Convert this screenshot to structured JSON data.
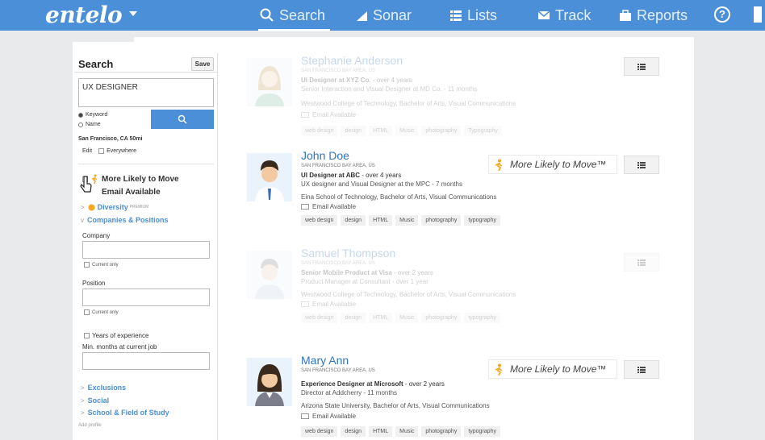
{
  "topbar": {
    "logo": "entelo",
    "nav": [
      {
        "label": "Search",
        "icon": "search-icon"
      },
      {
        "label": "Sonar",
        "icon": "signal-bars-icon"
      },
      {
        "label": "Lists",
        "icon": "list-icon"
      },
      {
        "label": "Track",
        "icon": "envelope-icon"
      },
      {
        "label": "Reports",
        "icon": "briefcase-icon"
      }
    ],
    "help": "?"
  },
  "sidebar": {
    "title": "Search",
    "save": "Save",
    "query": "UX DESIGNER",
    "radio_keyword": "Keyword",
    "radio_name": "Name",
    "location": "San Francisco, CA 50mi",
    "edit": "Edit",
    "everywhere": "Everywhere",
    "filter_move": "More Likely to Move",
    "filter_email": "Email Available",
    "diversity": "Diversity",
    "premium": "PREMIUM",
    "companies": "Companies & Positions",
    "company_label": "Company",
    "current_only": "Current only",
    "position_label": "Position",
    "years_exp": "Years of experience",
    "min_months": "Min. months at current job",
    "exclusions": "Exclusions",
    "social": "Social",
    "school": "School & Field of Study",
    "add_profile": "Add profile"
  },
  "mltm_label": "More Likely to Move™",
  "results": [
    {
      "name": "Stephanie Anderson",
      "location": "SAN FRANCISCO BAY AREA, US",
      "title_bold": "UI Designer at XYZ Co.",
      "title_rest": " - over 4 years",
      "role": "Senior Interaction and Visual Designer at MD Co. - 11 months",
      "education": "Westwood College of Technology, Bachelor of Arts, Visual Communications",
      "email": "Email Available",
      "tags": [
        "web design",
        "design",
        "HTML",
        "Music",
        "photography",
        "Typography"
      ]
    },
    {
      "name": "John Doe",
      "location": "SAN FRANCISCO BAY AREA, US",
      "title_bold": "UI Designer at ABC",
      "title_rest": " - over 4 years",
      "role": "UX designer and Visual Designer at the MPC - 7 months",
      "education": "Eina School of Technology, Bachelor of Arts, Visual Communications",
      "email": "Email Available",
      "tags": [
        "web design",
        "design",
        "HTML",
        "Music",
        "photography",
        "typography"
      ]
    },
    {
      "name": "Samuel Thompson",
      "location": "SAN FRANCISCO BAY AREA, US",
      "title_bold": "Senior Mobile Product at Visa",
      "title_rest": " - over 2 years",
      "role": "Product Manager at Consultant - over 1 year",
      "education": "Westwood College of Technology, Bachelor of Arts, Visual Communications",
      "email": "Email Available",
      "tags": [
        "web design",
        "design",
        "HTML",
        "Music",
        "photography",
        "typography"
      ]
    },
    {
      "name": "Mary Ann",
      "location": "SAN FRANCISCO BAY AREA, US",
      "title_bold": "Experience Designer at Microsoft",
      "title_rest": " - over 2 years",
      "role": "Director at Addcherry - 11 months",
      "education": "Arizona State University, Bachelor of Arts, Visual Communications",
      "email": "Email Available",
      "tags": [
        "web design",
        "design",
        "HTML",
        "Music",
        "photography",
        "typography"
      ]
    }
  ],
  "colors": {
    "brand": "#4a8fd8",
    "link": "#2f74c0",
    "accent": "#f5a623"
  }
}
